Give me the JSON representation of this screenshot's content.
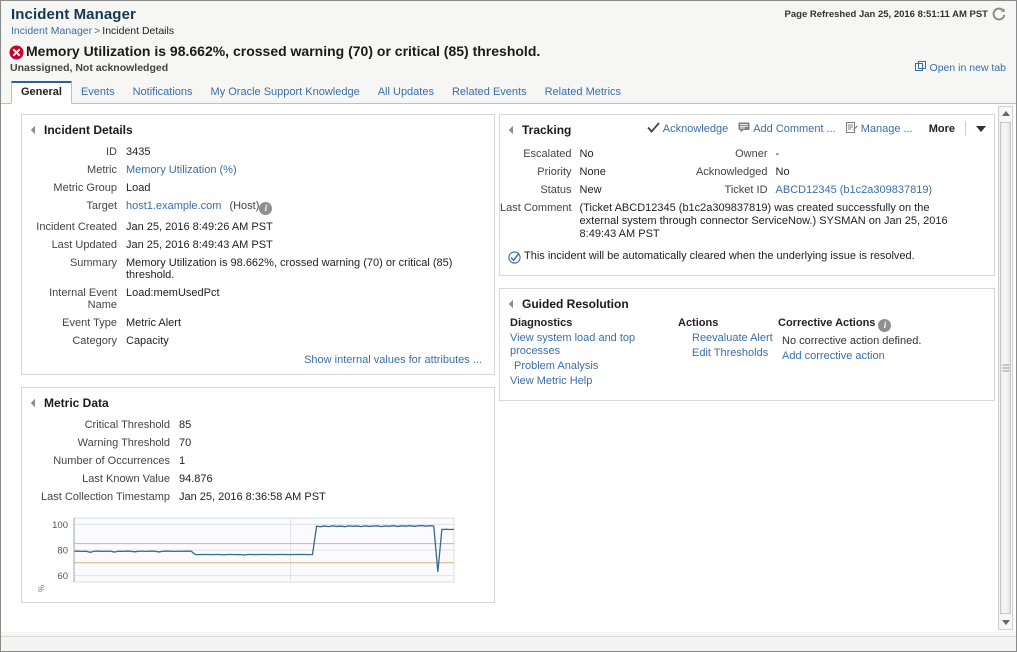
{
  "header": {
    "app_title": "Incident Manager",
    "breadcrumb_root": "Incident Manager",
    "breadcrumb_sep": ">",
    "breadcrumb_current": "Incident Details",
    "page_refreshed": "Page Refreshed Jan 25, 2016 8:51:11 AM PST",
    "refresh_icon": "refresh-icon"
  },
  "alert": {
    "status_icon": "error-icon",
    "title": "Memory Utilization is 98.662%, crossed warning (70) or critical (85) threshold.",
    "subtitle": "Unassigned, Not acknowledged",
    "open_in_new_tab": "Open in new tab",
    "open_icon": "external-link-icon"
  },
  "tabs": [
    {
      "label": "General",
      "active": true
    },
    {
      "label": "Events",
      "active": false
    },
    {
      "label": "Notifications",
      "active": false
    },
    {
      "label": "My Oracle Support Knowledge",
      "active": false
    },
    {
      "label": "All Updates",
      "active": false
    },
    {
      "label": "Related Events",
      "active": false
    },
    {
      "label": "Related Metrics",
      "active": false
    }
  ],
  "incident_details": {
    "title": "Incident Details",
    "rows": [
      {
        "label": "ID",
        "value": "3435",
        "link": false
      },
      {
        "label": "Metric",
        "value": "Memory Utilization (%)",
        "link": true
      },
      {
        "label": "Metric Group",
        "value": "Load",
        "link": false
      },
      {
        "label": "Target",
        "value": "host1.example.com",
        "link": true,
        "suffix": "(Host)",
        "info": true
      },
      {
        "label": "Incident Created",
        "value": "Jan 25, 2016 8:49:26 AM PST",
        "link": false
      },
      {
        "label": "Last Updated",
        "value": "Jan 25, 2016 8:49:43 AM PST",
        "link": false
      },
      {
        "label": "Summary",
        "value": "Memory Utilization is 98.662%, crossed warning (70) or critical (85) threshold.",
        "link": false
      },
      {
        "label": "Internal Event Name",
        "value": "Load:memUsedPct",
        "link": false
      },
      {
        "label": "Event Type",
        "value": "Metric Alert",
        "link": false
      },
      {
        "label": "Category",
        "value": "Capacity",
        "link": false
      }
    ],
    "show_internal": "Show internal values for attributes ..."
  },
  "tracking": {
    "title": "Tracking",
    "actions": [
      {
        "label": "Acknowledge",
        "icon": "check-icon"
      },
      {
        "label": "Add Comment ...",
        "icon": "comment-icon"
      },
      {
        "label": "Manage ...",
        "icon": "manage-icon"
      }
    ],
    "more_label": "More",
    "more_icon": "chevron-down-icon",
    "fields": [
      {
        "k1": "Escalated",
        "v1": "No",
        "k2": "Owner",
        "v2": "-",
        "v2link": false
      },
      {
        "k1": "Priority",
        "v1": "None",
        "k2": "Acknowledged",
        "v2": "No",
        "v2link": false
      },
      {
        "k1": "Status",
        "v1": "New",
        "k2": "Ticket ID",
        "v2": "ABCD12345 (b1c2a309837819)",
        "v2link": true
      }
    ],
    "last_comment_label": "Last Comment",
    "last_comment_value": "(Ticket  ABCD12345 (b1c2a309837819) was created successfully on the external system through connector ServiceNow.) SYSMAN on Jan 25, 2016 8:49:43 AM PST",
    "auto_clear_icon": "check-circle-icon",
    "auto_clear_text": "This incident will be automatically cleared when the underlying issue is resolved."
  },
  "guided_resolution": {
    "title": "Guided Resolution",
    "diagnostics": {
      "heading": "Diagnostics",
      "links": [
        "View system load and top processes",
        "Problem Analysis",
        "View Metric Help"
      ]
    },
    "actions": {
      "heading": "Actions",
      "links": [
        "Reevaluate Alert",
        "Edit Thresholds"
      ]
    },
    "corrective": {
      "heading": "Corrective Actions",
      "info_icon": "info-icon",
      "static_text": "No corrective action defined.",
      "links": [
        "Add corrective action"
      ]
    }
  },
  "metric_data": {
    "title": "Metric Data",
    "rows": [
      {
        "label": "Critical Threshold",
        "value": "85"
      },
      {
        "label": "Warning Threshold",
        "value": "70"
      },
      {
        "label": "Number of Occurrences",
        "value": "1"
      },
      {
        "label": "Last Known Value",
        "value": "94.876"
      },
      {
        "label": "Last Collection Timestamp",
        "value": "Jan 25, 2016 8:36:58 AM PST"
      }
    ]
  },
  "chart_data": {
    "type": "line",
    "title": "",
    "xlabel": "",
    "ylabel": "%",
    "ylim": [
      55,
      105
    ],
    "yticks": [
      60,
      80,
      100
    ],
    "grid": true,
    "legend": false,
    "series": [
      {
        "name": "Memory Utilization (%)",
        "color": "#35688c",
        "values": [
          79.0,
          79.1,
          78.9,
          79.0,
          78.2,
          79.0,
          79.1,
          78.9,
          79.0,
          79.0,
          78.4,
          79.0,
          78.9,
          79.1,
          79.0,
          78.6,
          79.0,
          79.0,
          78.9,
          79.1,
          79.0,
          78.5,
          79.0,
          79.1,
          79.0,
          78.9,
          79.0,
          79.0,
          79.1,
          79.0,
          76.5,
          76.4,
          76.5,
          76.5,
          76.4,
          76.5,
          76.5,
          76.2,
          76.5,
          76.5,
          76.4,
          76.5,
          76.1,
          76.5,
          76.5,
          76.4,
          76.5,
          76.5,
          76.5,
          76.4,
          76.5,
          76.5,
          76.5,
          76.4,
          76.5,
          76.5,
          76.5,
          76.5,
          76.4,
          76.5,
          98.6,
          98.2,
          98.8,
          98.3,
          98.9,
          98.4,
          98.7,
          98.2,
          98.9,
          98.5,
          98.8,
          98.3,
          98.9,
          98.4,
          98.7,
          98.9,
          98.3,
          98.8,
          98.5,
          99.0,
          98.4,
          98.9,
          98.6,
          99.0,
          98.5,
          98.8,
          99.1,
          98.6,
          99.0,
          98.7,
          63.0,
          96.0,
          96.2,
          96.0,
          96.1
        ]
      }
    ],
    "threshold_lines": [
      {
        "name": "critical",
        "value": 85,
        "color": "#e8a6a6"
      },
      {
        "name": "warning",
        "value": 70,
        "color": "#d8b47a"
      }
    ]
  },
  "scrollbar": {
    "up_icon": "arrow-up-icon",
    "down_icon": "arrow-down-icon",
    "thumb": "scroll-thumb"
  }
}
